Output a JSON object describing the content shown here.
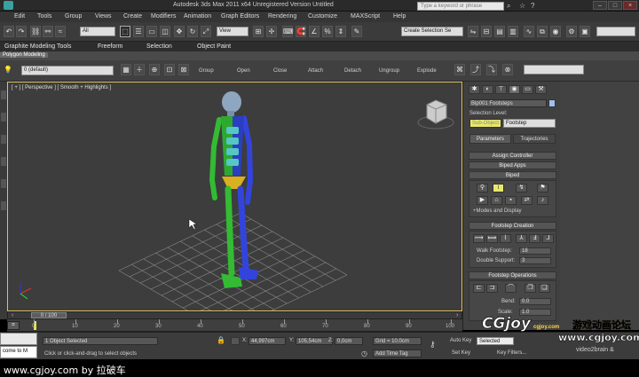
{
  "titlebar": {
    "title": "Autodesk 3ds Max  2011 x64    Unregistered Version    Untitled",
    "search_placeholder": "Type a keyword or phrase"
  },
  "menu": [
    "Edit",
    "Tools",
    "Group",
    "Views",
    "Create",
    "Modifiers",
    "Animation",
    "Graph Editors",
    "Rendering",
    "Customize",
    "MAXScript",
    "Help"
  ],
  "toolbar": {
    "filter": "All",
    "ref_coord": "View",
    "selection_set": "Create Selection Se"
  },
  "ribbon": {
    "tabs": [
      "Graphite Modeling Tools",
      "Freeform",
      "Selection",
      "Object Paint"
    ],
    "panel": "Polygon Modeling"
  },
  "subtool": {
    "layer": "0 (default)",
    "labels": [
      "Group",
      "Open",
      "Close",
      "Attach",
      "Detach",
      "Ungroup",
      "Explode"
    ]
  },
  "viewport": {
    "label": "[ + ] [ Perspective ] [ Smooth + Highlights ]"
  },
  "cmdpanel": {
    "object_name": "Bip001 Footsteps",
    "selection_level_label": "Selection Level:",
    "sub_anim": "Sub-Object",
    "level_value": "Footstep",
    "tabs": [
      "Parameters",
      "Trajectories"
    ],
    "rollouts": [
      "Assign Controller",
      "Biped Apps",
      "Biped"
    ],
    "modes_label": "+Modes and Display",
    "footstep_creation": "Footstep Creation",
    "walk_footstep_label": "Walk Footstep:",
    "walk_footstep": "18",
    "double_support_label": "Double Support:",
    "double_support": "3",
    "footstep_operations": "Footstep Operations",
    "bend_label": "Bend:",
    "bend": "0.0",
    "scale_label": "Scale:",
    "scale": "1.0"
  },
  "timeline": {
    "position": "0 / 100",
    "ticks": [
      "0",
      "10",
      "20",
      "30",
      "40",
      "50",
      "60",
      "70",
      "80",
      "90",
      "100"
    ]
  },
  "status": {
    "welcome": "come to M",
    "selected": "1 Object Selected",
    "prompt": "Click or click-and-drag to select objects",
    "x_label": "X:",
    "x": "44,997cm",
    "y_label": "Y:",
    "y": "105,54cm",
    "z_label": "Z:",
    "z": "0,0cm",
    "grid": "Grid = 10,0cm",
    "add_time_tag": "Add Time Tag",
    "auto_key": "Auto Key",
    "set_key": "Set Key",
    "selected_dropdown": "Selected",
    "key_filters": "Key Filters..."
  },
  "watermark": {
    "logo_text": "CGjoy",
    "domain": "cgjoy.com",
    "slogan": "游戏动画论坛",
    "url": "www.cgjoy.com",
    "extra": "video2brain &"
  },
  "credit": "www.cgjoy.com by 拉破车",
  "colors": {
    "accent": "#e0c060",
    "viewport_bg": "#3d3d3d",
    "left_limb": "#33bb33",
    "right_limb": "#3344dd",
    "head": "#8fa6c0"
  }
}
